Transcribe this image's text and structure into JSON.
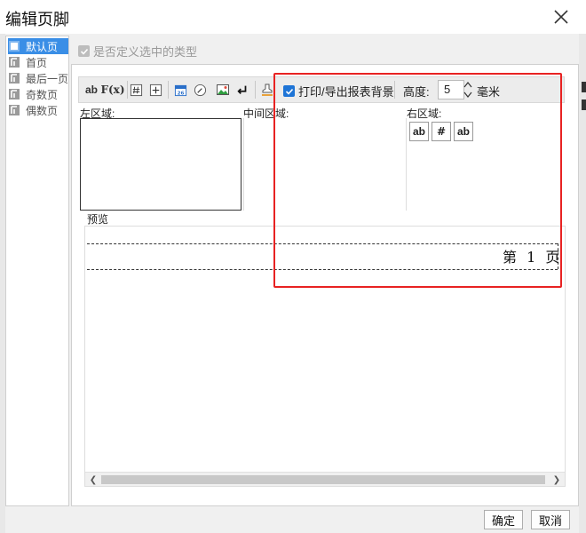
{
  "window": {
    "title": "编辑页脚"
  },
  "sidebar": {
    "items": [
      {
        "label": "默认页",
        "active": true
      },
      {
        "label": "首页",
        "active": false
      },
      {
        "label": "最后一页",
        "active": false
      },
      {
        "label": "奇数页",
        "active": false
      },
      {
        "label": "偶数页",
        "active": false
      }
    ]
  },
  "custom_type": {
    "label": "是否定义选中的类型",
    "checked": true,
    "enabled": false
  },
  "toolbar": {
    "text_btn": "ab",
    "formula_btn": "F(x)",
    "print_bg_label": "打印/导出报表背景",
    "print_bg_checked": true,
    "height_label": "高度:",
    "height_value": "5",
    "unit_label": "毫米",
    "icons": [
      "text-icon",
      "formula-icon",
      "page-number-icon",
      "total-pages-icon",
      "date-icon",
      "time-icon",
      "image-icon",
      "newline-icon",
      "background-icon"
    ]
  },
  "regions": {
    "left_label": "左区域:",
    "middle_label": "中间区域:",
    "right_label": "右区域:",
    "right_items": [
      "ab",
      "#",
      "ab"
    ]
  },
  "preview": {
    "label": "预览",
    "text": "第 1 页"
  },
  "buttons": {
    "ok": "确定",
    "cancel": "取消"
  },
  "colors": {
    "accent": "#3a8ee6",
    "highlight": "#e82222",
    "checkbox": "#1e74d6"
  }
}
